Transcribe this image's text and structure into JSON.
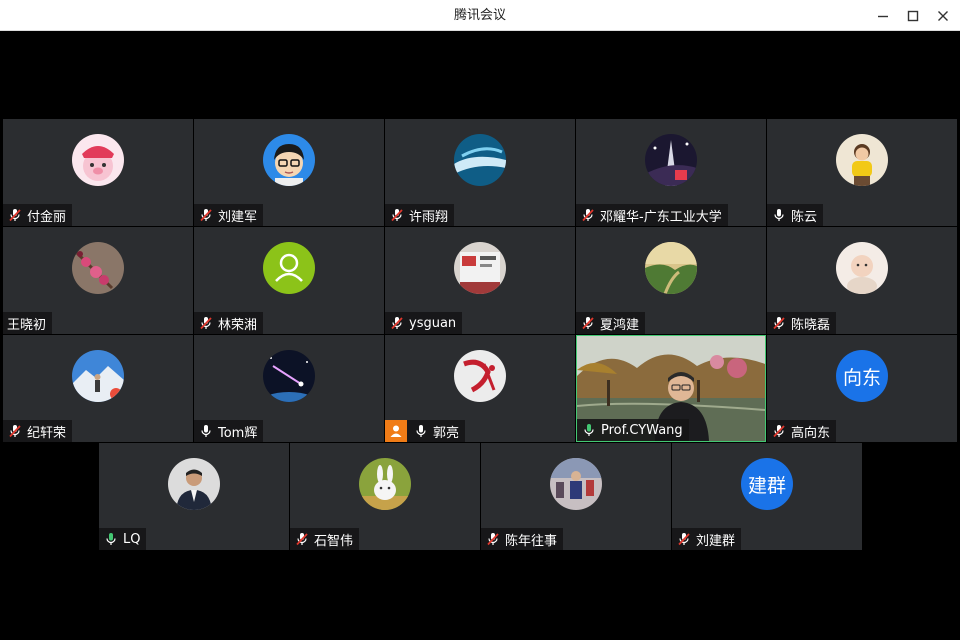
{
  "window": {
    "title": "腾讯会议"
  },
  "participants": [
    {
      "name": "付金丽",
      "mic": "muted",
      "avatar": "cartoon-pig-avatar"
    },
    {
      "name": "刘建军",
      "mic": "muted",
      "avatar": "cartoon-boy-glasses-avatar"
    },
    {
      "name": "许雨翔",
      "mic": "muted",
      "avatar": "abstract-blue-avatar"
    },
    {
      "name": "邓耀华-广东工业大学",
      "mic": "muted",
      "avatar": "night-city-avatar"
    },
    {
      "name": "陈云",
      "mic": "on-white",
      "avatar": "child-yellow-avatar"
    },
    {
      "name": "王晓初",
      "mic": "none",
      "avatar": "flower-branch-avatar"
    },
    {
      "name": "林荣湘",
      "mic": "muted",
      "avatar": "default-user-avatar"
    },
    {
      "name": "ysguan",
      "mic": "muted",
      "avatar": "poster-wall-avatar"
    },
    {
      "name": "夏鸿建",
      "mic": "muted",
      "avatar": "green-valley-avatar"
    },
    {
      "name": "陈晓磊",
      "mic": "muted",
      "avatar": "baby-photo-avatar"
    },
    {
      "name": "纪轩荣",
      "mic": "muted",
      "avatar": "snow-mountain-avatar"
    },
    {
      "name": "Tom辉",
      "mic": "on-white",
      "avatar": "comet-space-avatar"
    },
    {
      "name": "郭亮",
      "mic": "on-white",
      "avatar": "red-calligraphy-avatar",
      "host": true
    },
    {
      "name": "Prof.CYWang",
      "mic": "on-green",
      "avatar": "camera-video"
    },
    {
      "name": "高向东",
      "mic": "muted",
      "avatar_text": "向东"
    },
    {
      "name": "LQ",
      "mic": "on-green",
      "avatar": "man-suit-avatar"
    },
    {
      "name": "石智伟",
      "mic": "muted",
      "avatar": "white-rabbit-avatar"
    },
    {
      "name": "陈年往事",
      "mic": "muted",
      "avatar": "street-people-avatar"
    },
    {
      "name": "刘建群",
      "mic": "muted",
      "avatar_text": "建群"
    }
  ],
  "colors": {
    "accent": "#43c873",
    "mute": "#e0372d",
    "text_avatar": "#1a73e8",
    "host": "#f07c17"
  }
}
